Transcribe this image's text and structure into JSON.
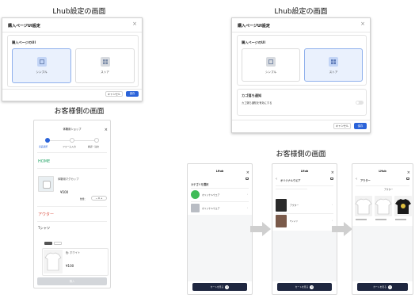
{
  "left": {
    "title": "Lhub設定の画面",
    "modal": {
      "title": "購入ページUI設定",
      "section_label": "購入ページのUI",
      "options": [
        {
          "title": "シンプル",
          "icon": "square-icon",
          "selected": true
        },
        {
          "title": "ストア",
          "icon": "store-grid-icon",
          "selected": false
        }
      ],
      "cancel_label": "キャンセル",
      "save_label": "保存"
    },
    "customer_title": "お客様側の画面",
    "phone": {
      "shop_name": "体験用ショップ",
      "steps": [
        "商品選択",
        "フォーム入力",
        "確認・注文"
      ],
      "categories": [
        "HOME",
        "アウター",
        "Tシャツ"
      ],
      "product1": {
        "name": "体験用マグカップ",
        "price": "¥500",
        "qty_label": "数量：",
        "qty": "0"
      },
      "product2": {
        "color_label": "色: ホワイト",
        "price": "¥100"
      },
      "next_label": "購入"
    }
  },
  "right": {
    "title": "Lhub設定の画面",
    "modal": {
      "title": "購入ページUI設定",
      "section_label": "購入ページのUI",
      "options": [
        {
          "title": "シンプル",
          "icon": "square-icon",
          "selected": false
        },
        {
          "title": "ストア",
          "icon": "store-grid-icon",
          "selected": true
        }
      ],
      "toggle_section_label": "カゴ落ち通知",
      "toggle_label": "カゴ落ち通知を有効にする",
      "cancel_label": "キャンセル",
      "save_label": "保存"
    },
    "customer_title": "お客様側の画面",
    "phones": [
      {
        "brand": "LHub",
        "section_label": "カテゴリを選択",
        "items": [
          "オリジナルウエア",
          "オリジナルウエア"
        ],
        "cart_label": "カートを見る",
        "cart_count": "0"
      },
      {
        "brand": "LHub",
        "section_label": "オリジナルウエア",
        "items": [
          "アウター",
          "Tシャツ"
        ],
        "cart_label": "カートを見る",
        "cart_count": "0"
      },
      {
        "brand": "LHub",
        "section_label": "アウター",
        "tabs": [
          "アウター"
        ],
        "cart_label": "カートを見る",
        "cart_count": "0"
      }
    ]
  },
  "colors": {
    "accent": "#2b63d9",
    "selected_bg": "#eaf1fd",
    "cart_bar": "#1f2740",
    "home_green": "#2aa76b",
    "outer_red": "#d94a3a"
  }
}
